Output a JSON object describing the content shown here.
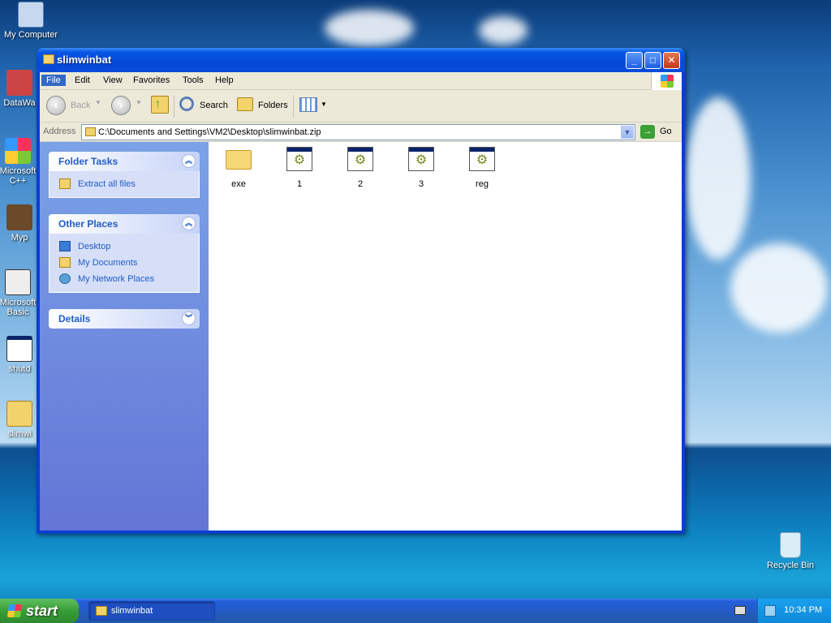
{
  "desktop": {
    "icons": [
      {
        "label": "My Computer"
      },
      {
        "label": "DataWa"
      },
      {
        "label": "Microsoft C++"
      },
      {
        "label": "Myp"
      },
      {
        "label": "Microsoft Basic"
      },
      {
        "label": "shutd"
      },
      {
        "label": "slimwi"
      },
      {
        "label": "Recycle Bin"
      }
    ]
  },
  "window": {
    "title": "slimwinbat",
    "controls": {
      "minimize": "_",
      "maximize": "□",
      "close": "✕"
    },
    "menu": [
      "File",
      "Edit",
      "View",
      "Favorites",
      "Tools",
      "Help"
    ],
    "toolbar": {
      "back": "Back",
      "search": "Search",
      "folders": "Folders"
    },
    "address": {
      "label": "Address",
      "value": "C:\\Documents and Settings\\VM2\\Desktop\\slimwinbat.zip",
      "go": "Go"
    },
    "task_pane": {
      "folder_tasks": {
        "title": "Folder Tasks",
        "items": [
          "Extract all files"
        ]
      },
      "other_places": {
        "title": "Other Places",
        "items": [
          "Desktop",
          "My Documents",
          "My Network Places"
        ]
      },
      "details": {
        "title": "Details"
      }
    },
    "files": [
      {
        "name": "exe",
        "icon": "folder-icon"
      },
      {
        "name": "1",
        "icon": "batch-file-icon"
      },
      {
        "name": "2",
        "icon": "batch-file-icon"
      },
      {
        "name": "3",
        "icon": "batch-file-icon"
      },
      {
        "name": "reg",
        "icon": "batch-file-icon"
      }
    ]
  },
  "taskbar": {
    "start": "start",
    "tasks": [
      {
        "label": "slimwinbat"
      }
    ],
    "clock": "10:34 PM"
  }
}
